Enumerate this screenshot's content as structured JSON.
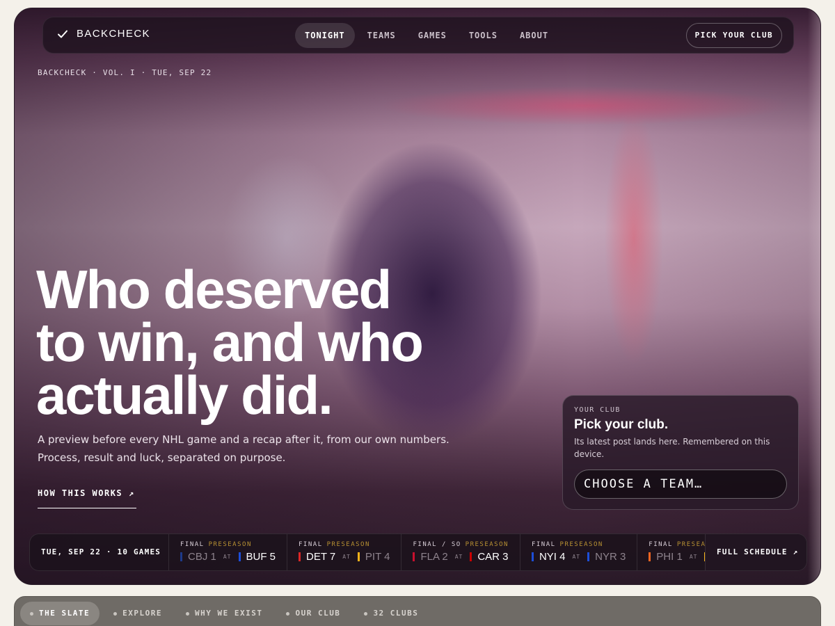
{
  "brand": {
    "name": "BACKCHECK"
  },
  "nav": {
    "links": [
      "TONIGHT",
      "TEAMS",
      "GAMES",
      "TOOLS",
      "ABOUT"
    ],
    "active": "TONIGHT",
    "pick_club": "PICK YOUR CLUB"
  },
  "hero": {
    "dateline": "BACKCHECK · VOL. I · TUE, SEP 22",
    "headline": [
      "Who deserved",
      "to win, and who",
      "actually did."
    ],
    "subcopy_1": "A preview before every NHL game and a recap after it, from our own numbers.",
    "subcopy_2": "Process, result and luck, separated on purpose.",
    "cta": "HOW THIS WORKS ↗"
  },
  "club_card": {
    "eyebrow": "YOUR CLUB",
    "title": "Pick your club.",
    "description": "Its latest post lands here. Remembered on this device.",
    "select_label": "CHOOSE A TEAM…"
  },
  "scores": {
    "date_label": "TUE, SEP 22 · 10 GAMES",
    "games": [
      {
        "status": "FINAL",
        "tag": "PRESEASON",
        "away": "CBJ 1",
        "away_color": "#1e3a8a",
        "away_lose": true,
        "home": "BUF 5",
        "home_color": "#1d4ed8",
        "home_lose": false
      },
      {
        "status": "FINAL",
        "tag": "PRESEASON",
        "away": "DET 7",
        "away_color": "#dc2626",
        "away_lose": false,
        "home": "PIT 4",
        "home_color": "#f5b31a",
        "home_lose": true
      },
      {
        "status": "FINAL / SO",
        "tag": "PRESEASON",
        "away": "FLA 2",
        "away_color": "#c8102e",
        "away_lose": true,
        "home": "CAR 3",
        "home_color": "#cc0000",
        "home_lose": false
      },
      {
        "status": "FINAL",
        "tag": "PRESEASON",
        "away": "NYI 4",
        "away_color": "#1d4ed8",
        "away_lose": false,
        "home": "NYR 3",
        "home_color": "#1d4ed8",
        "home_lose": true
      },
      {
        "status": "FINAL",
        "tag": "PRESEASON",
        "away": "PHI 1",
        "away_color": "#f26522",
        "away_lose": true,
        "home": "",
        "home_color": "#f5b31a",
        "home_lose": false
      }
    ],
    "full_schedule": "FULL SCHEDULE ↗"
  },
  "tabs": {
    "items": [
      "THE SLATE",
      "EXPLORE",
      "WHY WE EXIST",
      "OUR CLUB",
      "32 CLUBS"
    ],
    "active": "THE SLATE"
  },
  "colors": {
    "preseason_tag": "#b89133",
    "page_bg": "#f4f1ea",
    "tabs_bg": "#6f6b66"
  }
}
